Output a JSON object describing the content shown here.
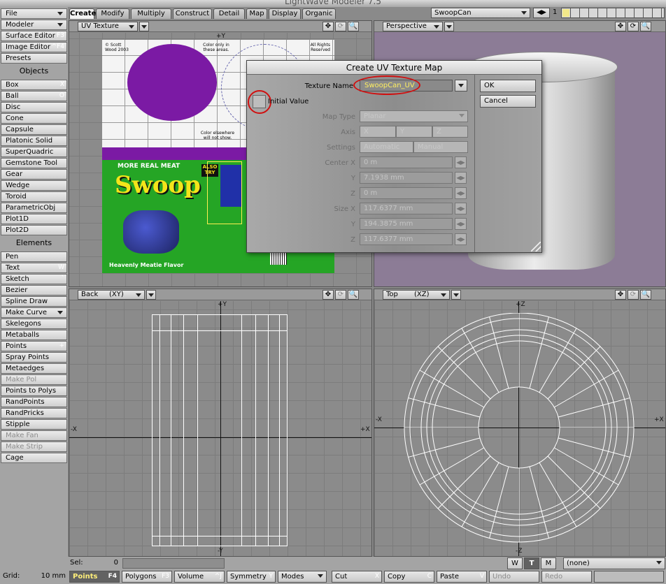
{
  "app": {
    "title": "LightWave Modeler 7.5"
  },
  "sidebar": {
    "top_buttons": [
      {
        "label": "File",
        "shortcut": "",
        "dropdown": true
      },
      {
        "label": "Modeler",
        "shortcut": "",
        "dropdown": true
      },
      {
        "label": "Surface Editor",
        "shortcut": "F3"
      },
      {
        "label": "Image Editor",
        "shortcut": "^F4"
      },
      {
        "label": "Presets",
        "shortcut": ""
      }
    ],
    "objects_header": "Objects",
    "objects": [
      {
        "label": "Box",
        "shortcut": "X"
      },
      {
        "label": "Ball",
        "shortcut": "O"
      },
      {
        "label": "Disc",
        "shortcut": ""
      },
      {
        "label": "Cone",
        "shortcut": ""
      },
      {
        "label": "Capsule",
        "shortcut": ""
      },
      {
        "label": "Platonic Solid",
        "shortcut": ""
      },
      {
        "label": "SuperQuadric",
        "shortcut": ""
      },
      {
        "label": "Gemstone Tool",
        "shortcut": ""
      },
      {
        "label": "Gear",
        "shortcut": ""
      },
      {
        "label": "Wedge",
        "shortcut": ""
      },
      {
        "label": "Toroid",
        "shortcut": ""
      },
      {
        "label": "ParametricObj",
        "shortcut": ""
      },
      {
        "label": "Plot1D",
        "shortcut": ""
      },
      {
        "label": "Plot2D",
        "shortcut": ""
      }
    ],
    "elements_header": "Elements",
    "elements": [
      {
        "label": "Pen",
        "shortcut": ""
      },
      {
        "label": "Text",
        "shortcut": "W"
      },
      {
        "label": "Sketch",
        "shortcut": "`"
      },
      {
        "label": "Bezier",
        "shortcut": ""
      },
      {
        "label": "Spline Draw",
        "shortcut": ""
      },
      {
        "label": "Make Curve",
        "shortcut": "",
        "dropdown": true
      },
      {
        "label": "Skelegons",
        "shortcut": ""
      },
      {
        "label": "Metaballs",
        "shortcut": ""
      },
      {
        "label": "Points",
        "shortcut": "+"
      },
      {
        "label": "Spray Points",
        "shortcut": ""
      },
      {
        "label": "Metaedges",
        "shortcut": ""
      },
      {
        "label": "Make Pol",
        "shortcut": "",
        "disabled": true
      },
      {
        "label": "Points to Polys",
        "shortcut": ""
      },
      {
        "label": "RandPoints",
        "shortcut": ""
      },
      {
        "label": "RandPricks",
        "shortcut": ""
      },
      {
        "label": "Stipple",
        "shortcut": ""
      },
      {
        "label": "Make Fan",
        "shortcut": "",
        "disabled": true
      },
      {
        "label": "Make Strip",
        "shortcut": "",
        "disabled": true
      },
      {
        "label": "Cage",
        "shortcut": ""
      }
    ]
  },
  "tabs": [
    "Create",
    "Modify",
    "Multiply",
    "Construct",
    "Detail",
    "Map",
    "Display",
    "Organic"
  ],
  "active_tab": "Create",
  "top_right": {
    "object_name": "SwoopCan",
    "layer_number": "1"
  },
  "viewports": {
    "top_left": {
      "title": "UV Texture",
      "axis_label": "+Y"
    },
    "top_right": {
      "title": "Perspective"
    },
    "bottom_left": {
      "view": "Back",
      "plane": "(XY)",
      "axis_top": "+Y",
      "axis_left": "-X",
      "axis_right": "+X",
      "axis_bottom": "-Y"
    },
    "bottom_right": {
      "view": "Top",
      "plane": "(XZ)",
      "axis_top": "+Z",
      "axis_left": "-X",
      "axis_right": "+X",
      "axis_bottom": "-Z"
    }
  },
  "label_art": {
    "copyright": "© Scott Wood 2003",
    "color_note": "Color only in these areas.",
    "rights": "All Rights Reserved",
    "color_note2": "Color elsewhere will not show.",
    "banner": "MORE REAL MEAT",
    "brand": "Swoop",
    "also": "ALSO TRY",
    "flavor": "Heavenly Meatie Flavor"
  },
  "dialog": {
    "title": "Create UV Texture Map",
    "texture_name_label": "Texture Name",
    "texture_name_value": "SwoopCan_UV",
    "initial_value_label": "Initial Value",
    "map_type_label": "Map Type",
    "map_type_value": "Planar",
    "axis_label": "Axis",
    "axis_options": [
      "X",
      "Y",
      "Z"
    ],
    "settings_label": "Settings",
    "settings_options": [
      "Automatic",
      "Manual"
    ],
    "center_x_label": "Center X",
    "center_x": "0 m",
    "center_y_label": "Y",
    "center_y": "7.1938 mm",
    "center_z_label": "Z",
    "center_z": "0 m",
    "size_x_label": "Size X",
    "size_x": "117.6377 mm",
    "size_y_label": "Y",
    "size_y": "194.3875 mm",
    "size_z_label": "Z",
    "size_z": "117.6377 mm",
    "ok_label": "OK",
    "cancel_label": "Cancel",
    "step_glyph": "◀▶"
  },
  "status": {
    "sel_label": "Sel:",
    "sel_value": "0",
    "wtm": [
      "W",
      "T",
      "M"
    ],
    "surface_value": "(none)"
  },
  "bottombar": {
    "grid_label": "Grid:",
    "grid_value": "10 mm",
    "points_label": "Points",
    "points_sc": "F4",
    "polygons_label": "Polygons",
    "polygons_sc": "F3",
    "volume_label": "Volume",
    "volume_sc": "^J",
    "symmetry_label": "Symmetry",
    "symmetry_sc": "Y",
    "modes_label": "Modes",
    "cut_label": "Cut",
    "cut_sc": "X",
    "copy_label": "Copy",
    "copy_sc": "C",
    "paste_label": "Paste",
    "paste_sc": "V",
    "undo_label": "Undo",
    "redo_label": "Redo"
  }
}
